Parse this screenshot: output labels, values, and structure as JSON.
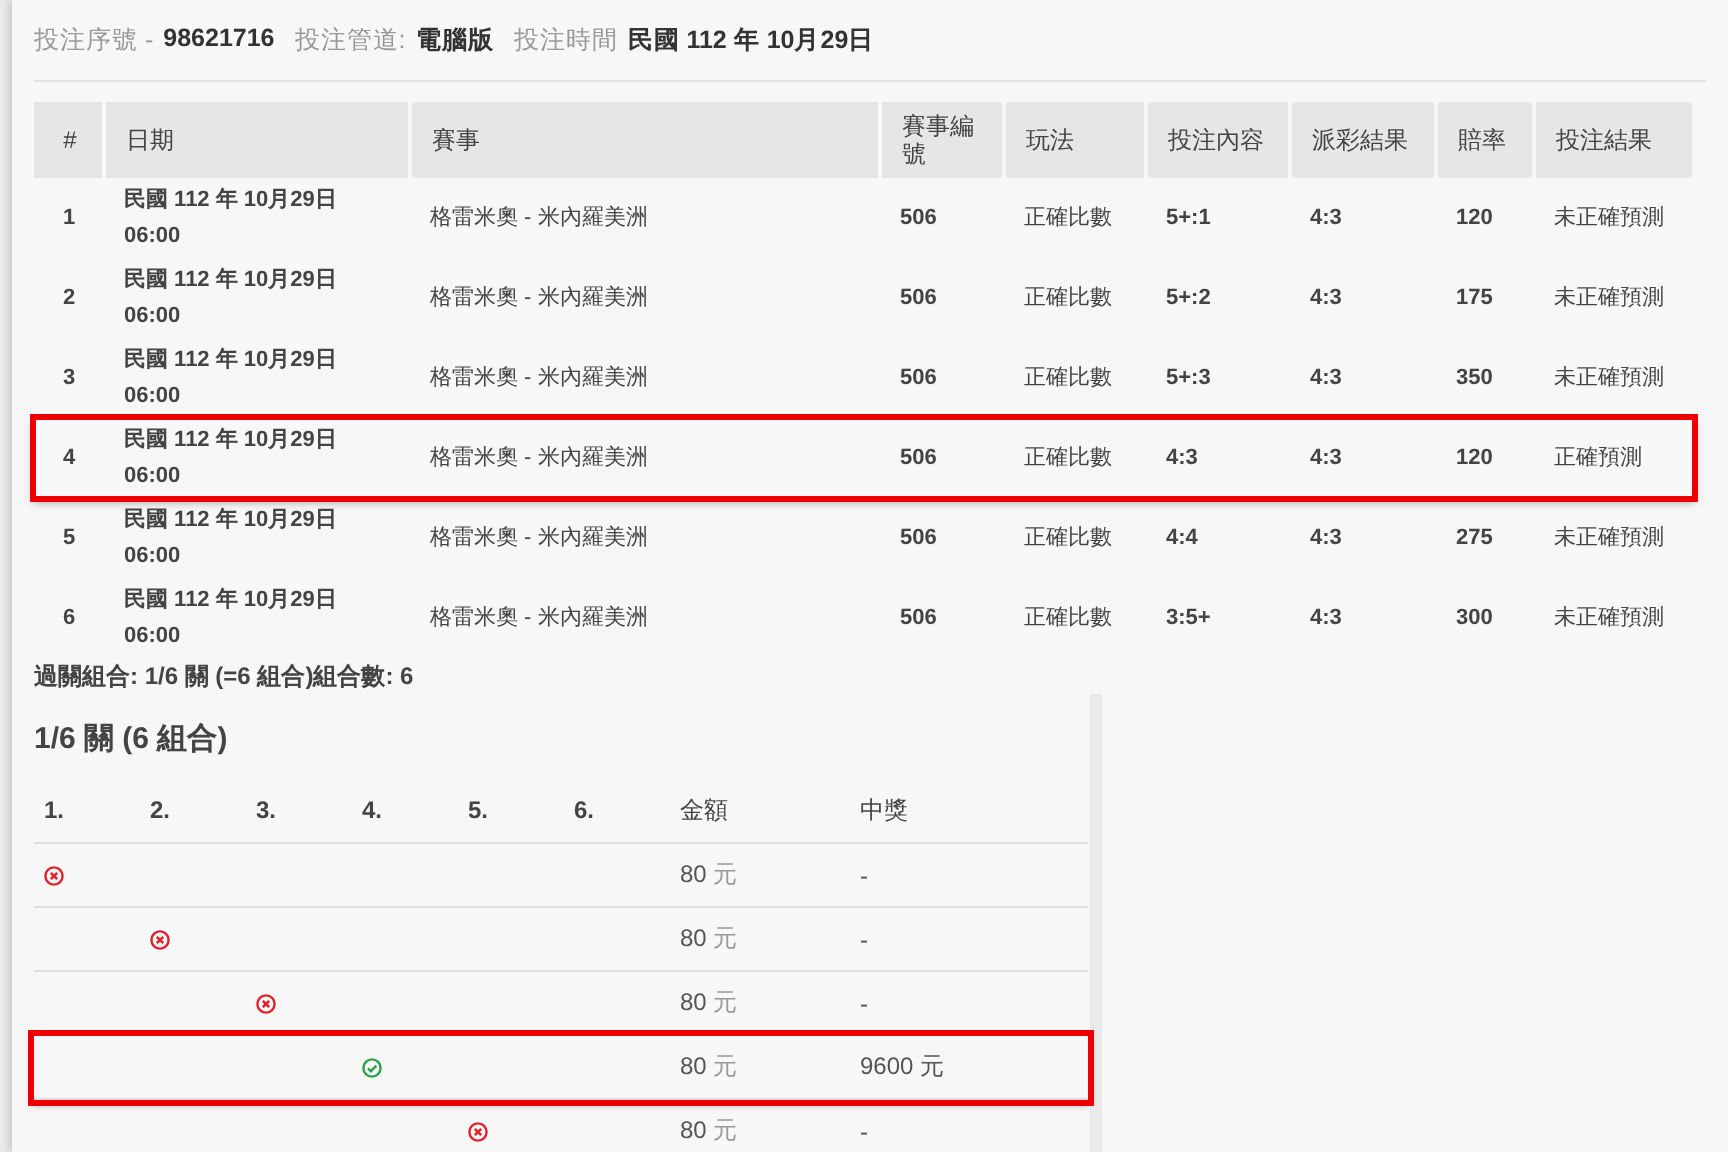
{
  "header": [
    {
      "label": "投注序號 -",
      "value": "98621716"
    },
    {
      "label": "投注管道:",
      "value": "電腦版"
    },
    {
      "label": "投注時間",
      "value": "民國 112 年 10月29日"
    }
  ],
  "table": {
    "columns": [
      "#",
      "日期",
      "賽事",
      "賽事編號",
      "玩法",
      "投注內容",
      "派彩結果",
      "賠率",
      "投注結果"
    ],
    "rows": [
      {
        "cells": [
          "1",
          "民國 112 年 10月29日 06:00",
          "格雷米奧 - 米內羅美洲",
          "506",
          "正確比數",
          "5+:1",
          "4:3",
          "120",
          "未正確預測"
        ],
        "highlighted": false
      },
      {
        "cells": [
          "2",
          "民國 112 年 10月29日 06:00",
          "格雷米奧 - 米內羅美洲",
          "506",
          "正確比數",
          "5+:2",
          "4:3",
          "175",
          "未正確預測"
        ],
        "highlighted": false
      },
      {
        "cells": [
          "3",
          "民國 112 年 10月29日 06:00",
          "格雷米奧 - 米內羅美洲",
          "506",
          "正確比數",
          "5+:3",
          "4:3",
          "350",
          "未正確預測"
        ],
        "highlighted": false
      },
      {
        "cells": [
          "4",
          "民國 112 年 10月29日 06:00",
          "格雷米奧 - 米內羅美洲",
          "506",
          "正確比數",
          "4:3",
          "4:3",
          "120",
          "正確預測"
        ],
        "highlighted": true
      },
      {
        "cells": [
          "5",
          "民國 112 年 10月29日 06:00",
          "格雷米奧 - 米內羅美洲",
          "506",
          "正確比數",
          "4:4",
          "4:3",
          "275",
          "未正確預測"
        ],
        "highlighted": false
      },
      {
        "cells": [
          "6",
          "民國 112 年 10月29日 06:00",
          "格雷米奧 - 米內羅美洲",
          "506",
          "正確比數",
          "3:5+",
          "4:3",
          "300",
          "未正確預測"
        ],
        "highlighted": false
      }
    ]
  },
  "summary": "過關組合: 1/6 關 (=6 組合)組合數: 6",
  "combos": {
    "title": "1/6 關 (6 組合)",
    "columns": [
      "1.",
      "2.",
      "3.",
      "4.",
      "5.",
      "6.",
      "金額",
      "中獎"
    ],
    "rows": [
      {
        "legs": [
          {
            "marked": true
          },
          {
            "marked": false
          },
          {
            "marked": false
          },
          {
            "marked": false
          },
          {
            "marked": false
          },
          {
            "marked": false
          }
        ],
        "won": false,
        "amount": "80",
        "unit": "元",
        "prize": "-",
        "highlighted": false
      },
      {
        "legs": [
          {
            "marked": false
          },
          {
            "marked": true
          },
          {
            "marked": false
          },
          {
            "marked": false
          },
          {
            "marked": false
          },
          {
            "marked": false
          }
        ],
        "won": false,
        "amount": "80",
        "unit": "元",
        "prize": "-",
        "highlighted": false
      },
      {
        "legs": [
          {
            "marked": false
          },
          {
            "marked": false
          },
          {
            "marked": true
          },
          {
            "marked": false
          },
          {
            "marked": false
          },
          {
            "marked": false
          }
        ],
        "won": false,
        "amount": "80",
        "unit": "元",
        "prize": "-",
        "highlighted": false
      },
      {
        "legs": [
          {
            "marked": false
          },
          {
            "marked": false
          },
          {
            "marked": false
          },
          {
            "marked": true
          },
          {
            "marked": false
          },
          {
            "marked": false
          }
        ],
        "won": true,
        "amount": "80",
        "unit": "元",
        "prize": "9600 元",
        "highlighted": true
      },
      {
        "legs": [
          {
            "marked": false
          },
          {
            "marked": false
          },
          {
            "marked": false
          },
          {
            "marked": false
          },
          {
            "marked": true
          },
          {
            "marked": false
          }
        ],
        "won": false,
        "amount": "80",
        "unit": "元",
        "prize": "-",
        "highlighted": false
      }
    ]
  }
}
